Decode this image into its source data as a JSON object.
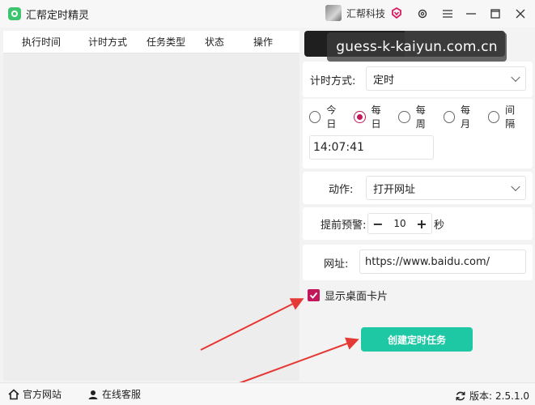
{
  "window": {
    "title": "汇帮定时精灵",
    "user_name": "汇帮科技",
    "controls": [
      "gear-icon",
      "menu-icon",
      "minimize-icon",
      "maximize-icon",
      "close-icon"
    ]
  },
  "table": {
    "columns": [
      "执行时间",
      "计时方式",
      "任务类型",
      "状态",
      "操作"
    ],
    "rows": []
  },
  "watermark": "guess-k-kaiyun.com.cn",
  "form": {
    "timer_mode_label": "计时方式:",
    "timer_mode_value": "定时",
    "frequency_options": [
      "今日",
      "每日",
      "每周",
      "每月",
      "间隔"
    ],
    "frequency_selected": "每日",
    "time_value": "14:07:41",
    "action_label": "动作:",
    "action_value": "打开网址",
    "advance_label": "提前预警:",
    "advance_value": "10",
    "advance_unit": "秒",
    "url_label": "网址:",
    "url_value": "https://www.baidu.com/",
    "show_card_label": "显示桌面卡片",
    "show_card_checked": true,
    "create_button": "创建定时任务"
  },
  "statusbar": {
    "website": "官方网站",
    "support": "在线客服",
    "version_label": "版本:",
    "version_value": "2.5.1.0"
  },
  "colors": {
    "accent_pink": "#c2185b",
    "button_teal": "#1ec8a5",
    "arrow_red": "#e53935"
  }
}
